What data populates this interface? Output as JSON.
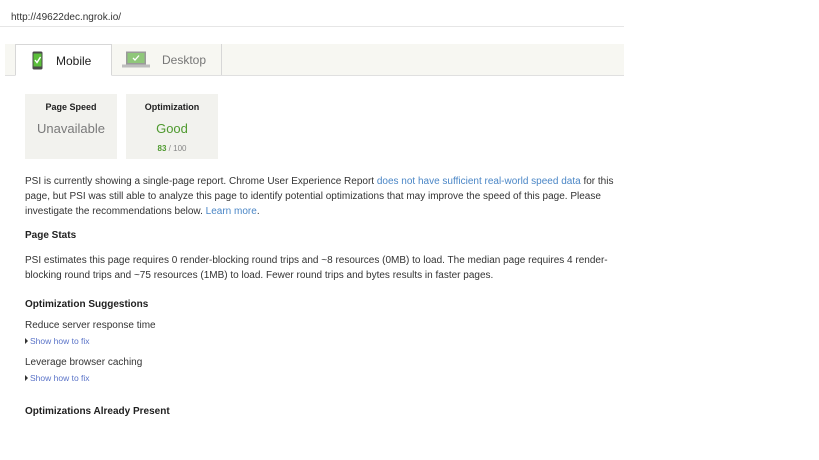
{
  "address_bar": {
    "url": "http://49622dec.ngrok.io/"
  },
  "tabs": [
    {
      "label": "Mobile",
      "icon": "mobile-phone-icon",
      "active": true
    },
    {
      "label": "Desktop",
      "icon": "laptop-icon",
      "active": false
    }
  ],
  "scores": {
    "page_speed": {
      "title": "Page Speed",
      "value": "Unavailable"
    },
    "optimization": {
      "title": "Optimization",
      "value": "Good",
      "score": "83",
      "max": "/ 100"
    }
  },
  "intro": {
    "text_before_link": "PSI is currently showing a single-page report. Chrome User Experience Report ",
    "link_text": "does not have sufficient real-world speed data",
    "text_after_link": " for this page, but PSI was still able to analyze this page to identify potential optimizations that may improve the speed of this page. Please investigate the recommendations below. ",
    "learn_more": "Learn more",
    "end": "."
  },
  "page_stats": {
    "heading": "Page Stats",
    "text": "PSI estimates this page requires 0 render-blocking round trips and ~8 resources (0MB) to load. The median page requires 4 render-blocking round trips and ~75 resources (1MB) to load. Fewer round trips and bytes results in faster pages."
  },
  "optimization_suggestions": {
    "heading": "Optimization Suggestions",
    "items": [
      {
        "title": "Reduce server response time",
        "link": "Show how to fix"
      },
      {
        "title": "Leverage browser caching",
        "link": "Show how to fix"
      }
    ]
  },
  "already_present": {
    "heading": "Optimizations Already Present"
  },
  "colors": {
    "good_green": "#4f9a2f",
    "link_blue": "#4a86c6",
    "card_bg": "#f2f2ee"
  }
}
